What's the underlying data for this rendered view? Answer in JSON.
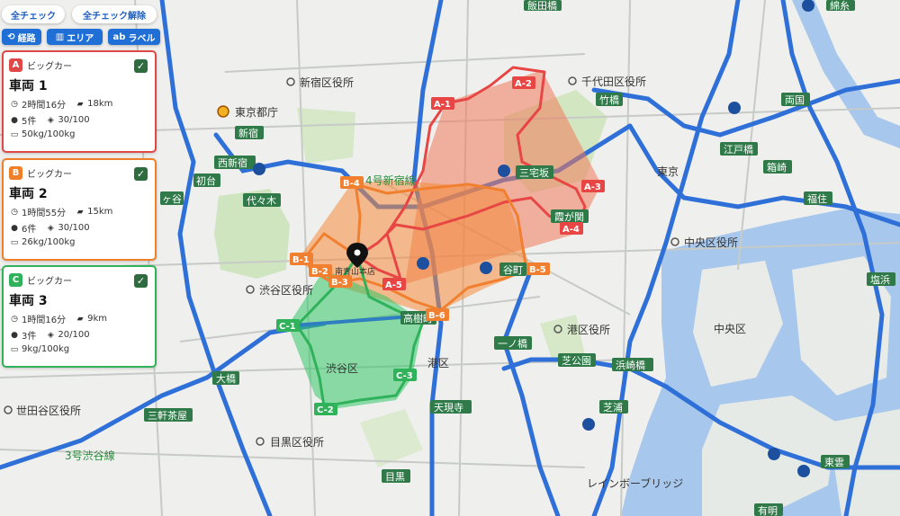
{
  "toolbar": {
    "check_all": "全チェック",
    "uncheck_all": "全チェック解除",
    "route": "経路",
    "area": "エリア",
    "label": "ラベル"
  },
  "vehicles": [
    {
      "id": "A",
      "type": "ビッグカー",
      "name": "車両 1",
      "time": "2時間16分",
      "distance": "18km",
      "stops": "5件",
      "capacity": "30/100",
      "load": "50kg/100kg",
      "color": "#e04848"
    },
    {
      "id": "B",
      "type": "ビッグカー",
      "name": "車両 2",
      "time": "1時間55分",
      "distance": "15km",
      "stops": "6件",
      "capacity": "30/100",
      "load": "26kg/100kg",
      "color": "#f07f2a"
    },
    {
      "id": "C",
      "type": "ビッグカー",
      "name": "車両 3",
      "time": "1時間16分",
      "distance": "9km",
      "stops": "3件",
      "capacity": "20/100",
      "load": "9kg/100kg",
      "color": "#2fb25a"
    }
  ],
  "stop_labels": {
    "a": [
      "A-1",
      "A-2",
      "A-3",
      "A-4",
      "A-5"
    ],
    "b": [
      "B-1",
      "B-2",
      "B-3",
      "B-4",
      "B-5",
      "B-6"
    ],
    "c": [
      "C-1",
      "C-2",
      "C-3"
    ]
  },
  "depot_label": "南青山本店",
  "map_labels": {
    "shinjuku_ward": "新宿区役所",
    "chiyoda_ward": "千代田区役所",
    "tokyo_metro": "東京都庁",
    "shibuya_ward": "渋谷区役所",
    "shibuya": "渋谷区",
    "minato": "港区",
    "minato_ward": "港区役所",
    "chuo_ward": "中央区役所",
    "chuo": "中央区",
    "setagaya_ward": "世田谷区役所",
    "meguro_ward": "目黒区役所",
    "tokyo": "東京",
    "rainbow_bridge": "レインボーブリッジ",
    "shibuya_line": "3号渋谷線",
    "shinjuku_line": "4号新宿線"
  },
  "stations": {
    "shinjuku": "新宿",
    "nishishinjuku": "西新宿",
    "hatsudai": "初台",
    "yoyogi": "代々木",
    "hatagaya": "ヶ谷",
    "takebashi": "竹橋",
    "miyakezaka": "三宅坂",
    "kasumigaseki": "霞が関",
    "tanimachi": "谷町",
    "takagi": "高樹町",
    "ichinohashi": "一ノ橋",
    "shibakoen": "芝公園",
    "hamazakibashi": "浜崎橋",
    "shibaura": "芝浦",
    "tengenji": "天現寺",
    "ohashi": "大橋",
    "sangenjaya": "三軒茶屋",
    "meguro": "目黒",
    "shinonome": "東雲",
    "ryogoku": "両国",
    "edobashi": "江戸橋",
    "hakozaki": "箱崎",
    "fukuzumi": "福住",
    "shiohama": "塩浜",
    "iidabashi": "飯田橋",
    "kuramae": "綿糸",
    "ariake": "有明"
  },
  "route_colors": {
    "a": "#e84545",
    "b": "#f08030",
    "c": "#2fb25a"
  }
}
